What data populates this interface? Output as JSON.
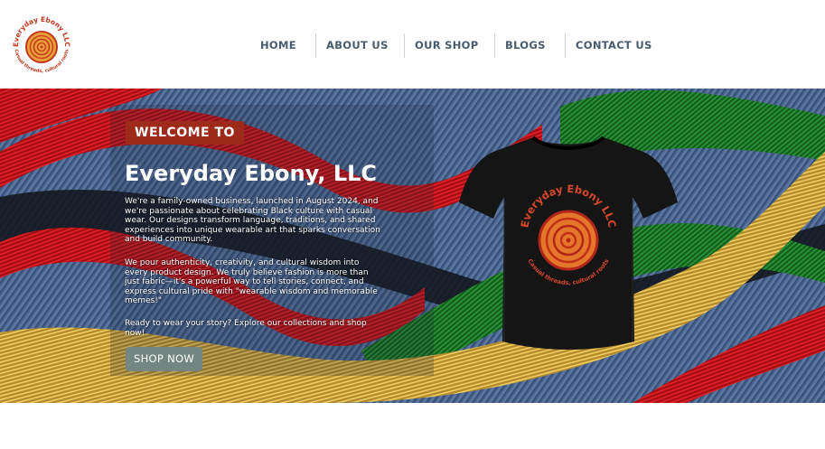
{
  "logo": {
    "text_top": "Everyday Ebony LLC",
    "text_bottom": "Casual threads, cultural roots",
    "icon": "spiral-icon"
  },
  "nav": {
    "items": [
      {
        "label": "HOME"
      },
      {
        "label": "ABOUT US"
      },
      {
        "label": "OUR SHOP"
      },
      {
        "label": "BLOGS"
      },
      {
        "label": "CONTACT US"
      }
    ]
  },
  "hero": {
    "badge": "WELCOME TO",
    "title": "Everyday Ebony, LLC",
    "paragraphs": [
      "We're a family-owned business, launched in August 2024, and we're passionate about celebrating Black culture with casual wear. Our designs transform language, traditions, and shared experiences into unique wearable art that sparks conversation and build community.",
      "We pour authenticity, creativity, and cultural wisdom into every product design. We truly believe fashion is more than just fabric—it's a powerful way to tell stories, connect, and express cultural pride with \"wearable wisdom and memorable memes!\"",
      "Ready to wear your story? Explore our collections and shop now!"
    ],
    "cta": "SHOP NOW"
  },
  "colors": {
    "badge_bg": "#9e2a1b",
    "cta_bg": "#748681",
    "nav_text": "#4a5b6e",
    "denim": "#3f5a82",
    "wave_red": "#c8141a",
    "wave_green": "#1e7a2a",
    "wave_gold": "#d8b040"
  }
}
